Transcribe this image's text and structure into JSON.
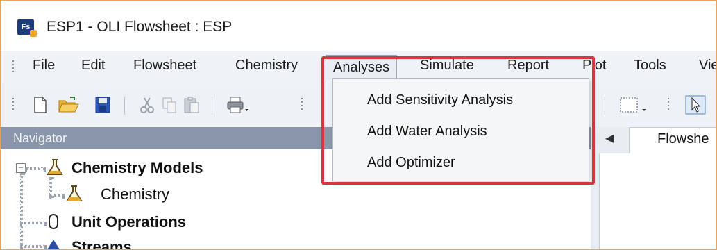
{
  "window": {
    "title": "ESP1 - OLI Flowsheet : ESP",
    "app_icon_text": "Fs"
  },
  "menubar": {
    "items": [
      {
        "label": "File"
      },
      {
        "label": "Edit"
      },
      {
        "label": "Flowsheet"
      },
      {
        "label": "Chemistry"
      },
      {
        "label": "Analyses",
        "active": true
      },
      {
        "label": "Simulate"
      },
      {
        "label": "Report"
      },
      {
        "label": "Plot"
      },
      {
        "label": "Tools"
      },
      {
        "label": "Vie"
      }
    ]
  },
  "analyses_menu": {
    "items": [
      {
        "label": "Add Sensitivity Analysis"
      },
      {
        "label": "Add Water Analysis"
      },
      {
        "label": "Add Optimizer"
      }
    ]
  },
  "navigator": {
    "header": "Navigator",
    "tree": [
      {
        "label": "Chemistry Models",
        "bold": true,
        "icon": "flask-icon",
        "expander": "−"
      },
      {
        "label": "Chemistry",
        "bold": false,
        "icon": "flask-icon"
      },
      {
        "label": "Unit Operations",
        "bold": true,
        "icon": "unit-operation-icon"
      },
      {
        "label": "Streams",
        "bold": true,
        "icon": "stream-arrow-icon"
      }
    ]
  },
  "document": {
    "tab_label": "Flowshe"
  },
  "colors": {
    "highlight": "#d8363d",
    "navigator_header": "#8a97ab"
  }
}
